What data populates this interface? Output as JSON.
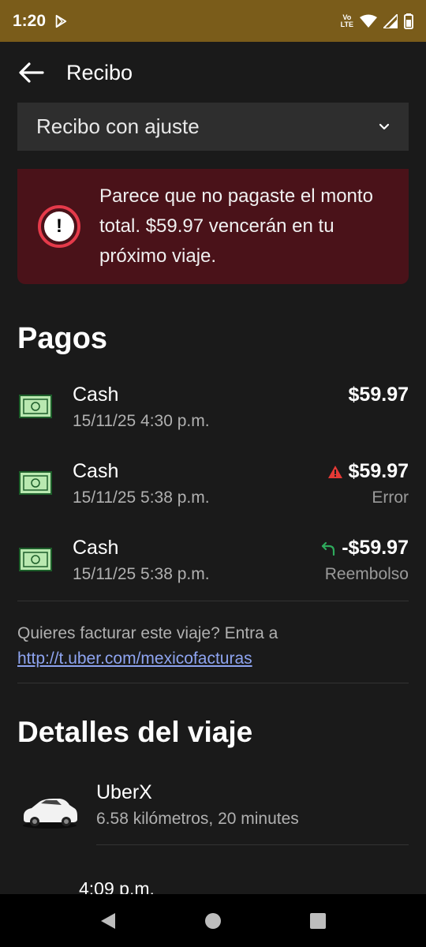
{
  "status_bar": {
    "time": "1:20",
    "volte_top": "Vo",
    "volte_bottom": "LTE"
  },
  "app_bar": {
    "title": "Recibo"
  },
  "dropdown": {
    "selected": "Recibo con ajuste"
  },
  "alert": {
    "message": "Parece que no pagaste el monto total. $59.97 vencerán en tu próximo viaje."
  },
  "payments": {
    "title": "Pagos",
    "items": [
      {
        "method": "Cash",
        "date": "15/11/25 4:30 p.m.",
        "amount": "$59.97",
        "status": ""
      },
      {
        "method": "Cash",
        "date": "15/11/25 5:38 p.m.",
        "amount": "$59.97",
        "status": "Error"
      },
      {
        "method": "Cash",
        "date": "15/11/25 5:38 p.m.",
        "amount": "-$59.97",
        "status": "Reembolso"
      }
    ]
  },
  "invoice": {
    "text": "Quieres facturar este viaje? Entra a",
    "link": "http://t.uber.com/mexicofacturas"
  },
  "trip_details": {
    "title": "Detalles del viaje",
    "product": "UberX",
    "meta": "6.58 kilómetros, 20 minutes",
    "next_time": "4:09 p.m."
  },
  "colors": {
    "status_bar": "#7a5c1a",
    "alert_bg": "#4a1219",
    "alert_accent": "#e53a4a",
    "link": "#8ea4f0",
    "error_icon": "#e53935",
    "refund_icon": "#2eaa5c"
  }
}
